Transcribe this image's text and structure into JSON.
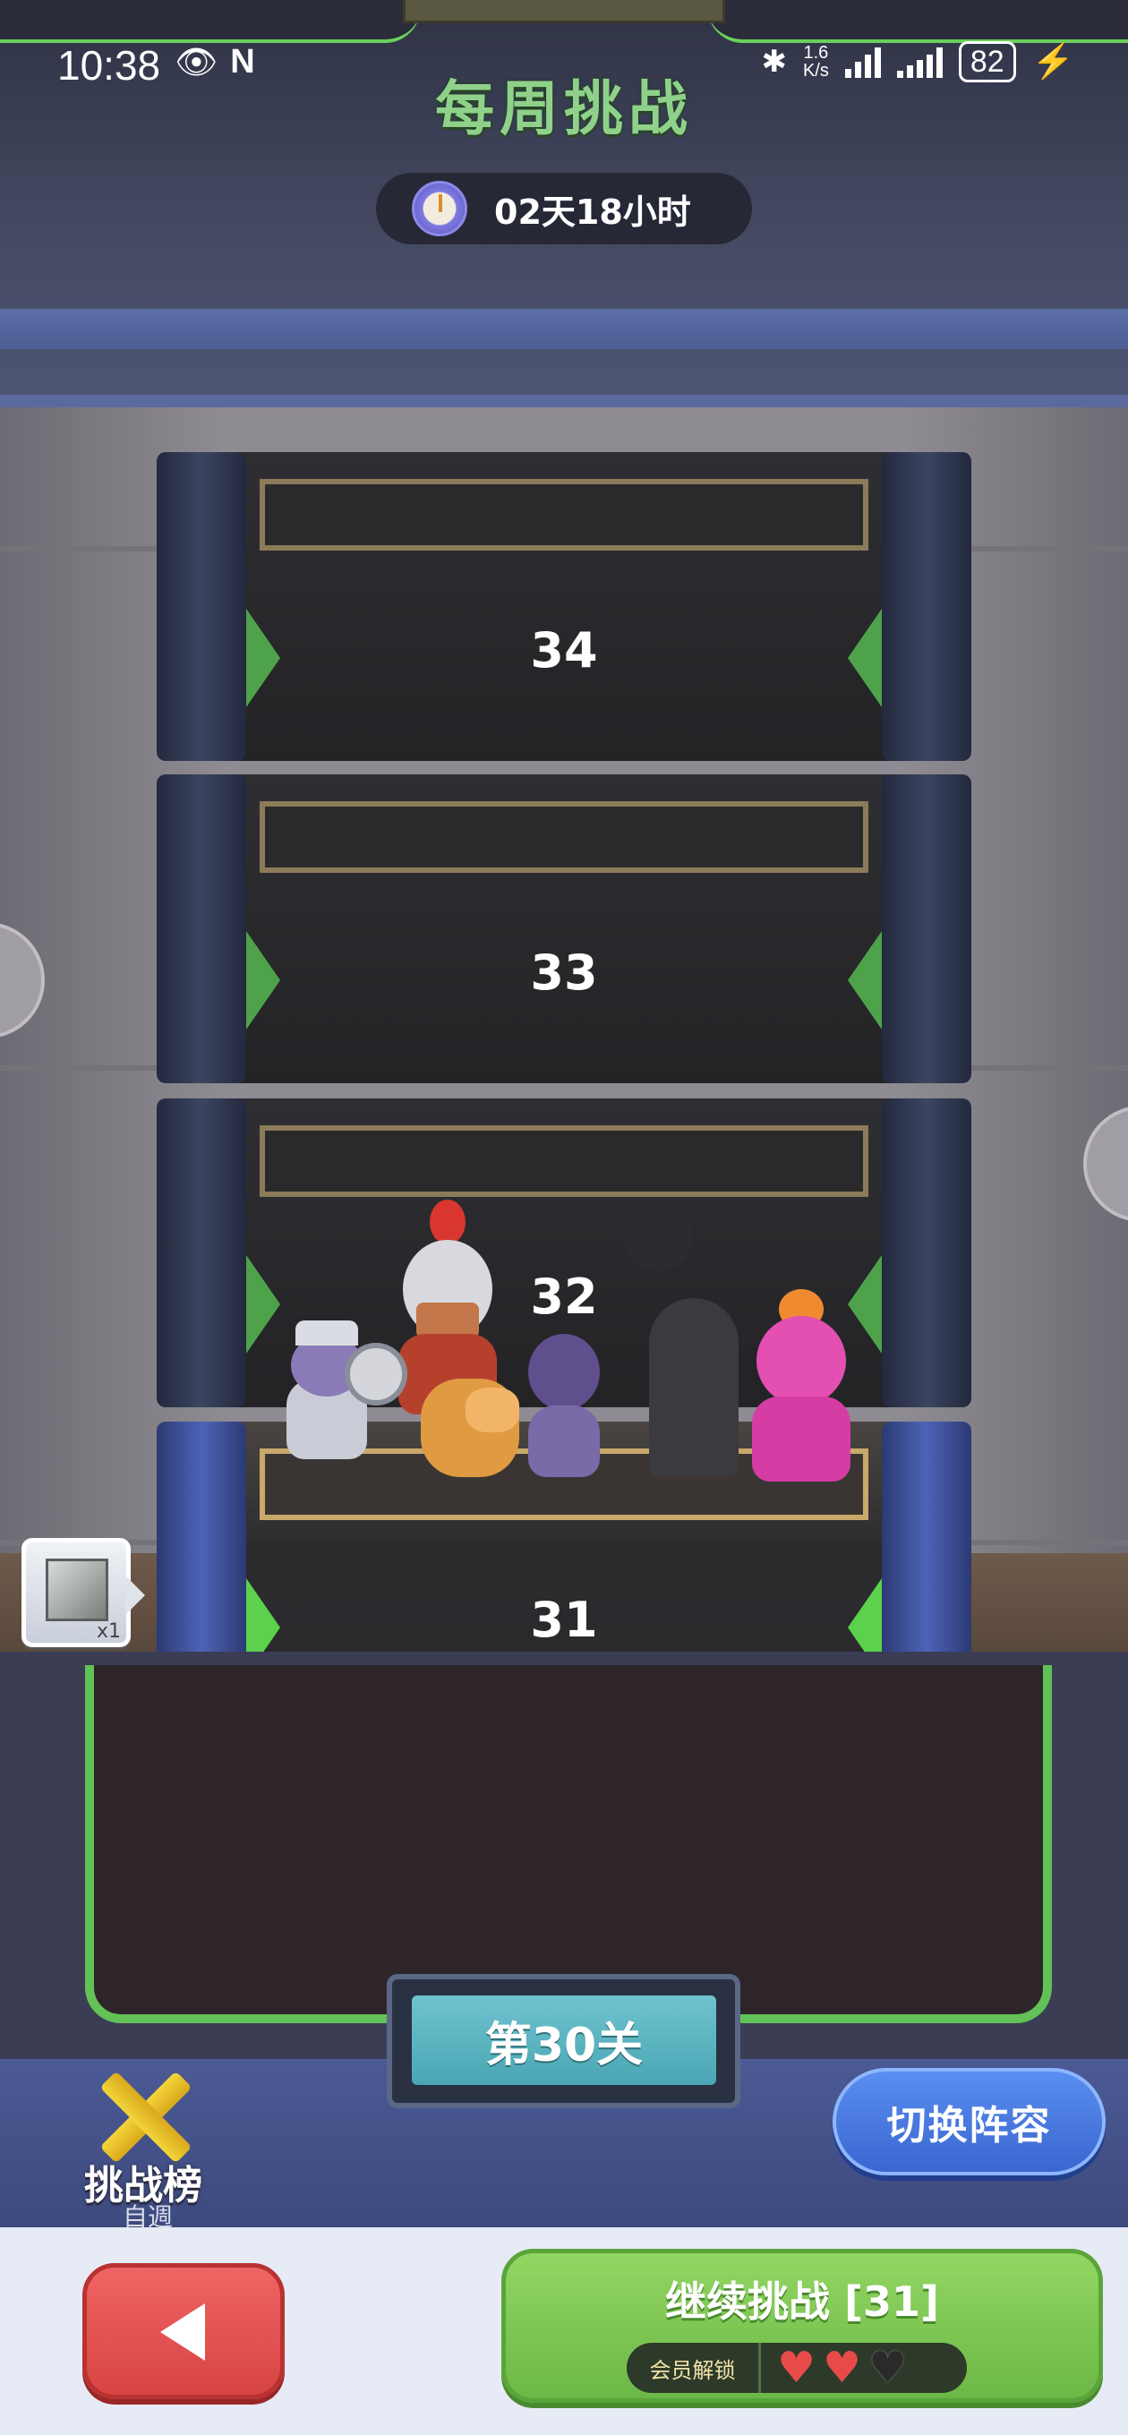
{
  "status_bar": {
    "time": "10:38",
    "net_speed_value": "1.6",
    "net_speed_unit": "K/s",
    "battery": "82"
  },
  "header": {
    "title": "每周挑战",
    "timer": "02天18小时"
  },
  "tower": {
    "floors": [
      {
        "number": "34",
        "active": false
      },
      {
        "number": "33",
        "active": false
      },
      {
        "number": "32",
        "active": false
      },
      {
        "number": "31",
        "active": true
      }
    ],
    "reward": {
      "count": "x1",
      "icon": "silver-cube-icon"
    }
  },
  "level_plate": {
    "label": "第30关"
  },
  "leaderboard": {
    "label": "挑战榜",
    "sub": "自週"
  },
  "switch_team": {
    "label": "切换阵容"
  },
  "bottom": {
    "continue_label": "继续挑战 [31]",
    "vip_label": "会员解锁",
    "hearts_full": 2,
    "hearts_total": 3
  },
  "colors": {
    "title_green": "#8fd18a",
    "continue_green": "#6cb846",
    "back_red": "#d84444",
    "switch_blue": "#3a66d0"
  }
}
